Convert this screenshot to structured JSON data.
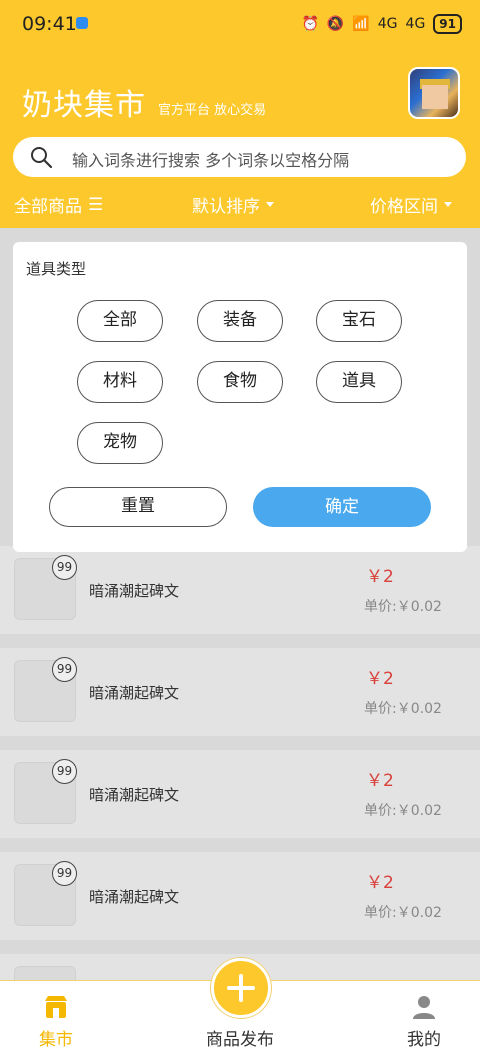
{
  "status_bar": {
    "time": "09:41",
    "battery": "91",
    "network1": "4G",
    "network2": "4G"
  },
  "header": {
    "title": "奶块集市",
    "subtitle": "官方平台 放心交易"
  },
  "search": {
    "placeholder": "输入词条进行搜索 多个词条以空格分隔"
  },
  "filters": {
    "all": "全部商品",
    "sort": "默认排序",
    "price": "价格区间"
  },
  "dropdown": {
    "title": "道具类型",
    "chips": [
      "全部",
      "装备",
      "宝石",
      "材料",
      "食物",
      "道具",
      "宠物"
    ],
    "reset_label": "重置",
    "confirm_label": "确定"
  },
  "items": [
    {
      "badge": "99",
      "name": "暗涌潮起碑文",
      "price": "￥2",
      "unit_price": "单价:￥0.02"
    },
    {
      "badge": "99",
      "name": "暗涌潮起碑文",
      "price": "￥2",
      "unit_price": "单价:￥0.02"
    },
    {
      "badge": "99",
      "name": "暗涌潮起碑文",
      "price": "￥2",
      "unit_price": "单价:￥0.02"
    },
    {
      "badge": "99",
      "name": "暗涌潮起碑文",
      "price": "￥2",
      "unit_price": "单价:￥0.02"
    }
  ],
  "tabs": {
    "market": "集市",
    "publish": "商品发布",
    "mine": "我的"
  },
  "colors": {
    "brand": "#fcc82c",
    "confirm": "#4aa8ef",
    "price": "#d9403a"
  }
}
